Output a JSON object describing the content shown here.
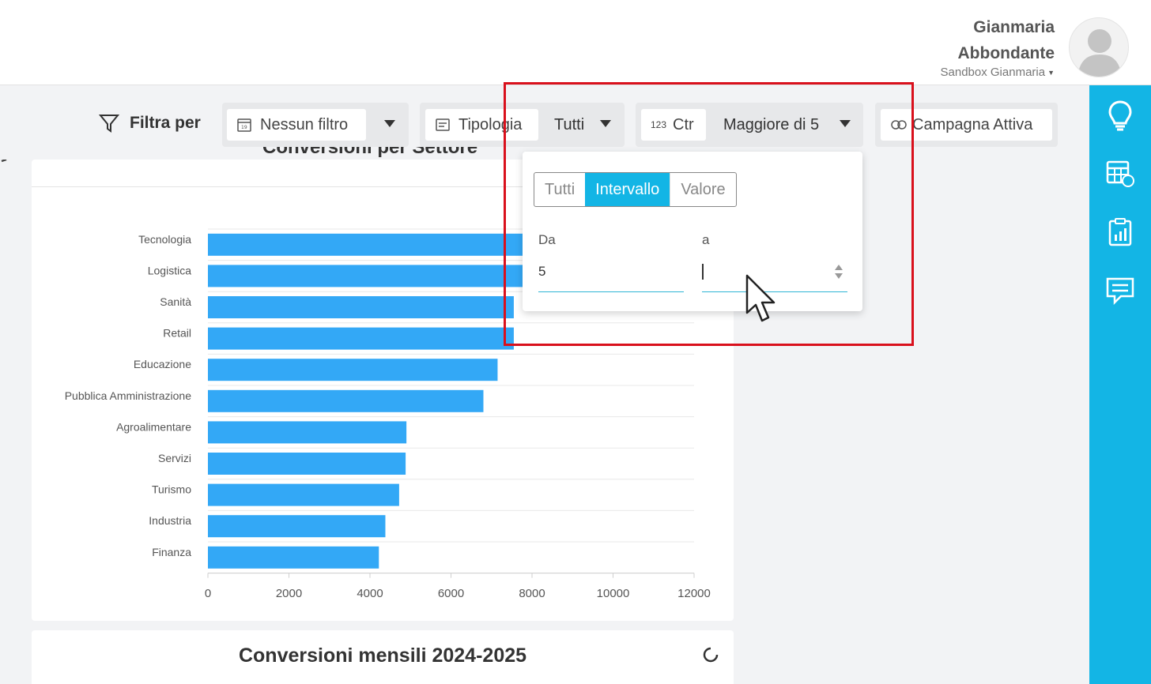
{
  "header": {
    "user_first": "Gianmaria",
    "user_last": "Abbondante",
    "workspace": "Sandbox Gianmaria",
    "avatar_icon": "user-avatar-icon"
  },
  "rail": {
    "color": "#13b5e5",
    "icons": [
      "lightbulb-icon",
      "table-help-icon",
      "clipboard-chart-icon",
      "chat-icon"
    ]
  },
  "filters": {
    "title": "Filtra per",
    "date_filter": "Nessun filtro",
    "tipologia_label": "Tipologia",
    "tipologia_value": "Tutti",
    "ctr_badge": "123",
    "ctr_label": "Ctr",
    "ctr_value": "Maggiore di 5",
    "campagna_label": "Campagna Attiva"
  },
  "popup": {
    "tabs": [
      "Tutti",
      "Intervallo",
      "Valore"
    ],
    "active_tab": "Intervallo",
    "from_label": "Da",
    "from_value": "5",
    "to_label": "a",
    "to_value": ""
  },
  "card1": {
    "title": "Conversioni per Settore"
  },
  "card2": {
    "title": "Conversioni mensili 2024-2025"
  },
  "chart_data": {
    "type": "bar",
    "orientation": "horizontal",
    "title": "Conversioni per Settore",
    "categories": [
      "Tecnologia",
      "Logistica",
      "Sanità",
      "Retail",
      "Educazione",
      "Pubblica Amministrazione",
      "Agroalimentare",
      "Servizi",
      "Turismo",
      "Industria",
      "Finanza"
    ],
    "values": [
      10500,
      10100,
      7550,
      7550,
      7150,
      6800,
      4900,
      4880,
      4720,
      4380,
      4220
    ],
    "xticks": [
      "0",
      "2000",
      "4000",
      "6000",
      "8000",
      "10000",
      "12000"
    ],
    "xlim": [
      0,
      12000
    ],
    "color": "#33a8f6",
    "grid": true
  }
}
